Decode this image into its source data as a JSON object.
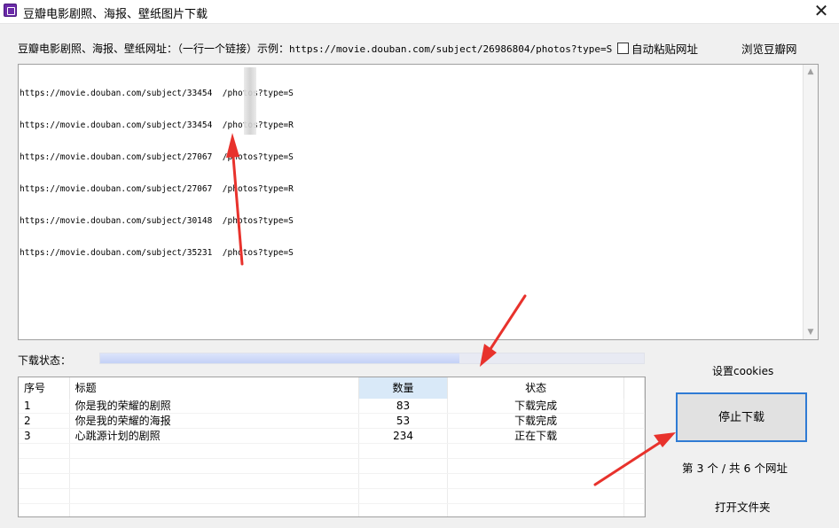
{
  "window": {
    "title": "豆瓣电影剧照、海报、壁纸图片下载",
    "close_glyph": "✕"
  },
  "url_input": {
    "label": "豆瓣电影剧照、海报、壁纸网址：（一行一个链接）示例：",
    "example": "https://movie.douban.com/subject/26986804/photos?type=S",
    "lines": [
      "https://movie.douban.com/subject/33454  /photos?type=S",
      "https://movie.douban.com/subject/33454  /photos?type=R",
      "https://movie.douban.com/subject/27067  /photos?type=S",
      "https://movie.douban.com/subject/27067  /photos?type=R",
      "https://movie.douban.com/subject/30148  /photos?type=S",
      "https://movie.douban.com/subject/35231  /photos?type=S"
    ]
  },
  "auto_paste": {
    "label": "自动粘贴网址",
    "checked": false
  },
  "browse_link": "浏览豆瓣网",
  "download_status": {
    "label": "下载状态：",
    "progress": 0.66
  },
  "table": {
    "columns": [
      "序号",
      "标题",
      "数量",
      "状态"
    ],
    "rows": [
      [
        "1",
        "你是我的荣耀的剧照",
        "83",
        "下载完成"
      ],
      [
        "2",
        "你是我的荣耀的海报",
        "53",
        "下载完成"
      ],
      [
        "3",
        "心跳源计划的剧照",
        "234",
        "正在下载"
      ]
    ]
  },
  "sidebar": {
    "cookies_link": "设置cookies",
    "stop_button": "停止下载",
    "count_label": "第 3 个 / 共 6 个网址",
    "open_folder": "打开文件夹"
  },
  "colors": {
    "accent_border": "#2f7bd4",
    "annotation_arrow": "#e8322c",
    "progress_fill": "#c4d1f6",
    "sorted_header": "#d9e9f8"
  }
}
